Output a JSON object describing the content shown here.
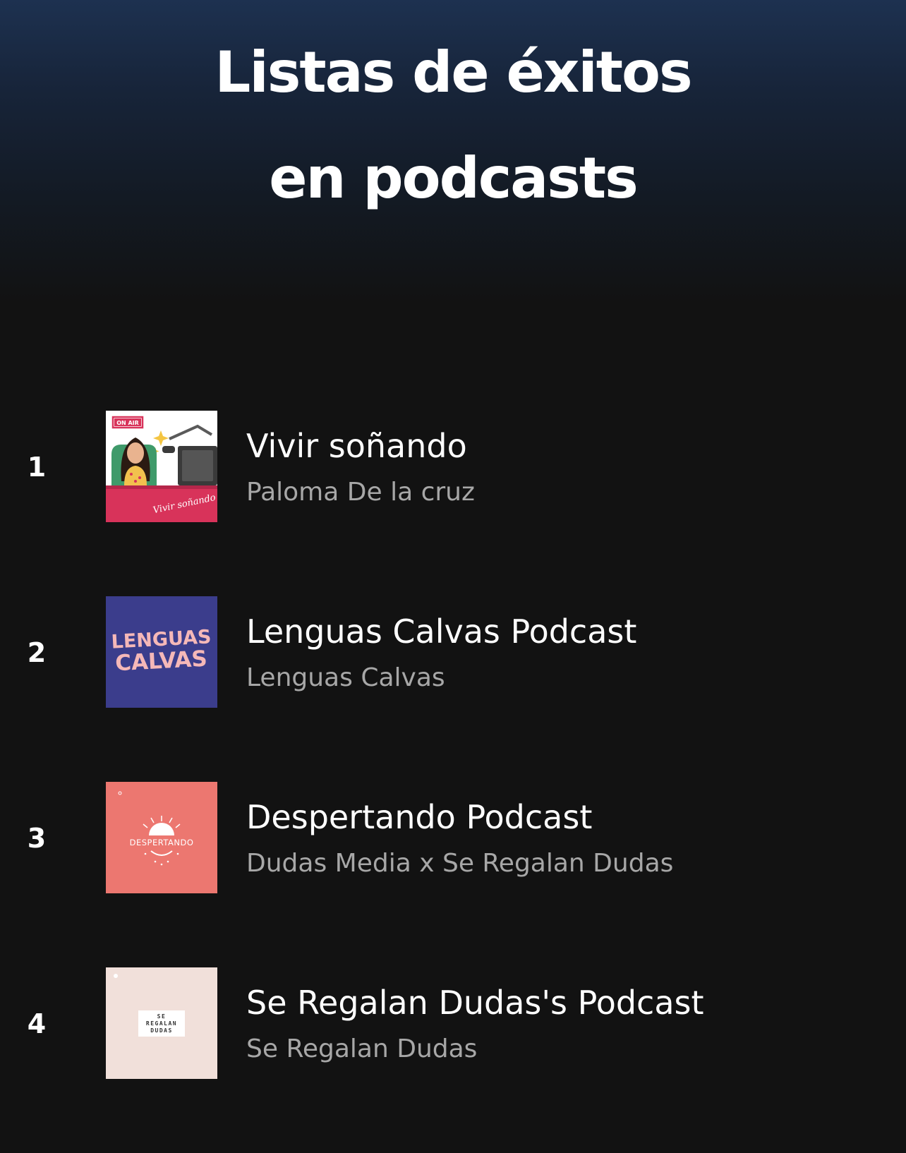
{
  "page": {
    "title_line1": "Listas de éxitos",
    "title_line2": "en podcasts"
  },
  "podcasts": [
    {
      "rank": "1",
      "title": "Vivir soñando",
      "author": "Paloma De la cruz",
      "cover": {
        "name": "vivir-sonando-cover",
        "badge": "ON AIR",
        "script": "Vivir soñando",
        "colors": {
          "bg": "#ffffff",
          "desk": "#d8335a",
          "chair": "#3f9a6a",
          "shirt": "#f2c14e",
          "hair": "#2b1a12",
          "skin": "#e9b38f",
          "mic": "#3a3a3a",
          "sparkle": "#f4c542"
        }
      }
    },
    {
      "rank": "2",
      "title": "Lenguas Calvas Podcast",
      "author": "Lenguas Calvas",
      "cover": {
        "name": "lenguas-calvas-cover",
        "line1": "LENGUAS",
        "line2": "CALVAS",
        "colors": {
          "bg": "#3b3d8c",
          "text": "#f5b8b8"
        }
      }
    },
    {
      "rank": "3",
      "title": "Despertando Podcast",
      "author": "Dudas Media x Se Regalan Dudas",
      "cover": {
        "name": "despertando-cover",
        "text": "DESPERTANDO",
        "colors": {
          "bg": "#ec7770",
          "text": "#ffffff"
        }
      }
    },
    {
      "rank": "4",
      "title": "Se Regalan Dudas's Podcast",
      "author": "Se Regalan Dudas",
      "cover": {
        "name": "se-regalan-dudas-cover",
        "line1": "SE",
        "line2": "REGALAN",
        "line3": "DUDAS",
        "colors": {
          "bg": "#f1e0da",
          "label_bg": "#ffffff",
          "text": "#333333"
        }
      }
    }
  ],
  "theme": {
    "background": "#121212",
    "header_gradient_top": "#1d3150",
    "primary_text": "#ffffff",
    "secondary_text": "#a7a7a7"
  }
}
